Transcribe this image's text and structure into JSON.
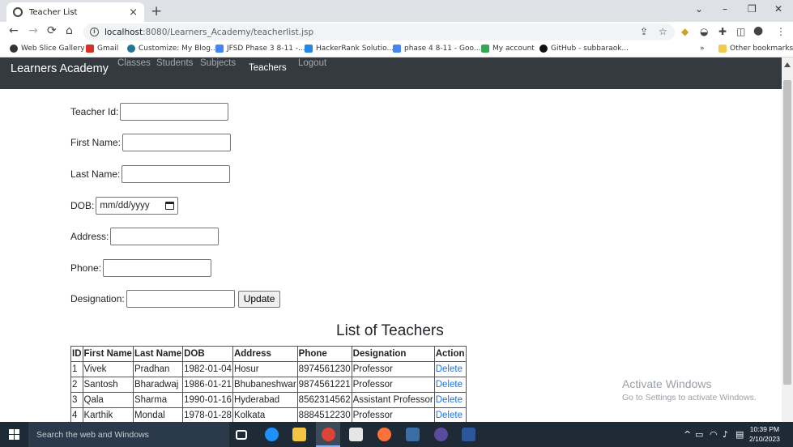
{
  "browser": {
    "tab_title": "Teacher List",
    "close_glyph": "×",
    "new_tab_glyph": "+",
    "url_host": "localhost",
    "url_path": ":8080/Learners_Academy/teacherlist.jsp",
    "window_controls": [
      "⌄",
      "–",
      "❐",
      "✕"
    ],
    "nav": {
      "back": "←",
      "forward": "→",
      "reload": "⟳",
      "home": "⌂"
    }
  },
  "bookmarks": [
    {
      "label": "Web Slice Gallery",
      "color": "#333333"
    },
    {
      "label": "Gmail",
      "color": "#d93025"
    },
    {
      "label": "Customize: My Blog...",
      "color": "#21759b"
    },
    {
      "label": "JFSD Phase 3 8-11 -...",
      "color": "#4285f4"
    },
    {
      "label": "HackerRank Solutio...",
      "color": "#1e88e5"
    },
    {
      "label": "phase 4 8-11 - Goo...",
      "color": "#4285f4"
    },
    {
      "label": "My account",
      "color": "#34a853"
    },
    {
      "label": "GitHub - subbaraok...",
      "color": "#111111"
    }
  ],
  "bookmarks_more": "»",
  "other_bookmarks": "Other bookmarks",
  "navbar": {
    "brand": "Learners Academy",
    "links": [
      "Classes",
      "Students",
      "Subjects",
      "Teachers",
      "Logout"
    ]
  },
  "form": {
    "teacher_id_label": "Teacher Id:",
    "first_name_label": "First Name:",
    "last_name_label": "Last Name:",
    "dob_label": "DOB:",
    "dob_placeholder": "mm/dd/yyyy",
    "address_label": "Address:",
    "phone_label": "Phone:",
    "designation_label": "Designation:",
    "update_button": "Update"
  },
  "table": {
    "title": "List of Teachers",
    "headers": [
      "ID",
      "First Name",
      "Last Name",
      "DOB",
      "Address",
      "Phone",
      "Designation",
      "Action"
    ],
    "rows": [
      [
        "1",
        "Vivek",
        "Pradhan",
        "1982-01-04",
        "Hosur",
        "8974561230",
        "Professor",
        "Delete"
      ],
      [
        "2",
        "Santosh",
        "Bharadwaj",
        "1986-01-21",
        "Bhubaneshwar",
        "9874561221",
        "Professor",
        "Delete"
      ],
      [
        "3",
        "Qala",
        "Sharma",
        "1990-01-16",
        "Hyderabad",
        "8562314562",
        "Assistant Professor",
        "Delete"
      ],
      [
        "4",
        "Karthik",
        "Mondal",
        "1978-01-28",
        "Kolkata",
        "8884512230",
        "Professor",
        "Delete"
      ]
    ]
  },
  "watermark": {
    "line1": "Activate Windows",
    "line2": "Go to Settings to activate Windows."
  },
  "taskbar": {
    "search_placeholder": "Search the web and Windows",
    "time": "10:39 PM",
    "date": "2/10/2023",
    "tray_glyph": "^"
  }
}
